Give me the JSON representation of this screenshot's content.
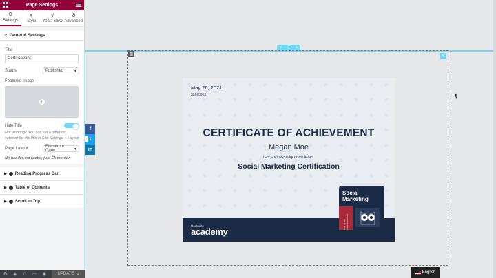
{
  "panel": {
    "title": "Page Settings",
    "tabs": [
      {
        "label": "Settings",
        "icon": "gear-icon"
      },
      {
        "label": "Style",
        "icon": "contrast-icon"
      },
      {
        "label": "Yoast SEO",
        "icon": "yoast-icon"
      },
      {
        "label": "Advanced",
        "icon": "gear-icon"
      }
    ],
    "general_settings": "General Settings",
    "title_label": "Title",
    "title_value": "Certifications",
    "status_label": "Status",
    "status_value": "Published",
    "featured_image_label": "Featured Image",
    "hide_title_label": "Hide Title",
    "hide_title_note": "Not working? You can set a different selector for the title in Site Settings > Layout",
    "page_layout_label": "Page Layout",
    "page_layout_value": "Elementor Canv",
    "page_layout_note": "No header, no footer, just Elementor",
    "collapsed_sections": [
      "Reading Progress Bar",
      "Table of Contents",
      "Scroll to Top"
    ],
    "update_label": "UPDATE"
  },
  "certificate": {
    "date": "May 26, 2021",
    "number": "32665955",
    "title": "CERTIFICATE OF ACHIEVEMENT",
    "name": "Megan Moe",
    "subtitle": "has successfully completed:",
    "course": "Social Marketing Certification",
    "brand_small": "Hootsuite",
    "brand_large": "academy",
    "badge_line1": "Social",
    "badge_line2": "Marketing",
    "badge_vertical": "CERTIFIED PROFESSIONAL"
  },
  "share": [
    "f",
    "t",
    "in"
  ],
  "language": "English",
  "colors": {
    "header": "#93003a",
    "accent": "#71d7f7",
    "navy": "#1b2b45",
    "badge_red": "#ab2a3a"
  }
}
